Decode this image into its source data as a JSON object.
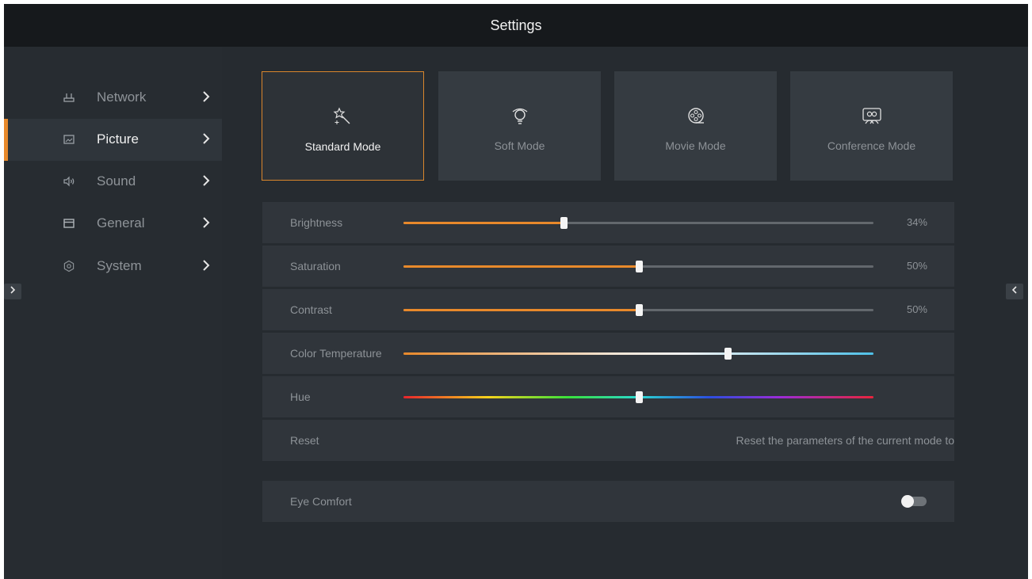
{
  "window": {
    "title": "Settings"
  },
  "sidebar": {
    "items": [
      {
        "label": "Network",
        "icon": "router-icon",
        "active": false
      },
      {
        "label": "Picture",
        "icon": "picture-icon",
        "active": true
      },
      {
        "label": "Sound",
        "icon": "speaker-icon",
        "active": false
      },
      {
        "label": "General",
        "icon": "window-icon",
        "active": false
      },
      {
        "label": "System",
        "icon": "gear-icon",
        "active": false
      }
    ]
  },
  "modes": [
    {
      "label": "Standard Mode",
      "icon": "magic-wand-icon",
      "selected": true
    },
    {
      "label": "Soft Mode",
      "icon": "lightbulb-icon",
      "selected": false
    },
    {
      "label": "Movie Mode",
      "icon": "film-reel-icon",
      "selected": false
    },
    {
      "label": "Conference Mode",
      "icon": "meeting-people-icon",
      "selected": false
    }
  ],
  "sliders": {
    "brightness": {
      "label": "Brightness",
      "value": "34%",
      "level": 0.34
    },
    "saturation": {
      "label": "Saturation",
      "value": "50%",
      "level": 0.5
    },
    "contrast": {
      "label": "Contrast",
      "value": "50%",
      "level": 0.5
    },
    "color_temperature": {
      "label": "Color Temperature",
      "level": 0.69
    },
    "hue": {
      "label": "Hue",
      "level": 0.5
    }
  },
  "reset": {
    "label": "Reset",
    "description": "Reset the parameters of the current mode to"
  },
  "eye_comfort": {
    "label": "Eye Comfort",
    "on": false
  },
  "colors": {
    "accent": "#e8892b",
    "background": "#262b30",
    "titlebar": "#16191c",
    "row": "#30353b"
  }
}
